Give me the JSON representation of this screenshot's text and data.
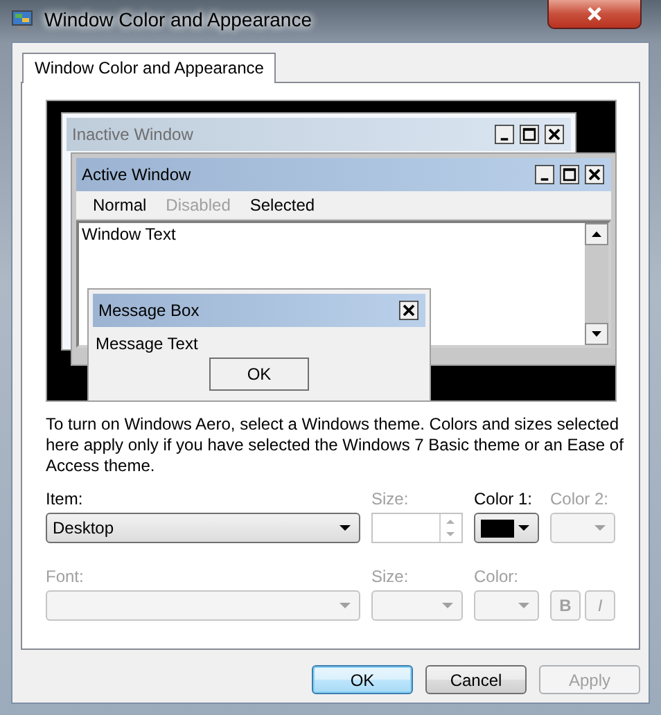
{
  "window": {
    "title": "Window Color and Appearance"
  },
  "tabs": [
    {
      "label": "Window Color and Appearance",
      "selected": true
    }
  ],
  "preview": {
    "inactive_window": {
      "title": "Inactive Window"
    },
    "active_window": {
      "title": "Active Window",
      "menu": [
        {
          "label": "Normal",
          "disabled": false
        },
        {
          "label": "Disabled",
          "disabled": true
        },
        {
          "label": "Selected",
          "disabled": false
        }
      ],
      "window_text": "Window Text"
    },
    "message_box": {
      "title": "Message Box",
      "text": "Message Text",
      "button": "OK"
    }
  },
  "description": "To turn on Windows Aero, select a Windows theme.  Colors and sizes selected here apply only if you have selected the Windows 7 Basic theme or an Ease of Access theme.",
  "item_row": {
    "item": {
      "label": "Item:",
      "value": "Desktop",
      "disabled": false
    },
    "size": {
      "label": "Size:",
      "disabled": true
    },
    "color_1": {
      "label": "Color 1:",
      "disabled": false,
      "color": "#000000"
    },
    "color_2": {
      "label": "Color 2:",
      "disabled": true
    }
  },
  "font_row": {
    "font": {
      "label": "Font:",
      "disabled": true
    },
    "size": {
      "label": "Size:",
      "disabled": true
    },
    "color": {
      "label": "Color:",
      "disabled": true
    },
    "bold": {
      "label": "B",
      "disabled": true
    },
    "italic": {
      "label": "I",
      "disabled": true
    }
  },
  "buttons": [
    {
      "label": "OK",
      "disabled": false,
      "default": true
    },
    {
      "label": "Cancel",
      "disabled": false,
      "default": false
    },
    {
      "label": "Apply",
      "disabled": true,
      "default": false
    }
  ]
}
